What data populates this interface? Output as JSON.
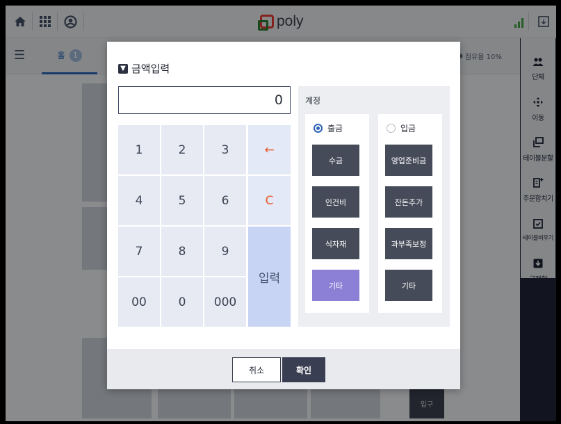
{
  "topbar": {
    "icons": [
      "home-icon",
      "grid-icon",
      "user-icon"
    ],
    "logo_text": "poly",
    "right_icons": [
      "signal-icon",
      "window-icon"
    ]
  },
  "subbar": {
    "hall_tab": "홀",
    "hall_count": "1",
    "occupancy": "점유율 10%"
  },
  "entrance_label": "입구",
  "sidebar": {
    "items": [
      {
        "label": "단체",
        "icon": "group-icon"
      },
      {
        "label": "이동",
        "icon": "move-icon"
      },
      {
        "label": "테이블분할",
        "icon": "split-icon"
      },
      {
        "label": "주문합치기",
        "icon": "merge-order-icon"
      },
      {
        "label": "테이블비우기",
        "icon": "clear-table-icon"
      },
      {
        "label": "금전함",
        "icon": "cash-drawer-icon"
      }
    ]
  },
  "dialog": {
    "title": "금액입력",
    "amount_value": "0",
    "keypad": {
      "row1": [
        "1",
        "2",
        "3"
      ],
      "row2": [
        "4",
        "5",
        "6"
      ],
      "row3": [
        "7",
        "8",
        "9"
      ],
      "row4": [
        "00",
        "0",
        "000"
      ],
      "backspace": "←",
      "clear": "C",
      "enter": "입력"
    },
    "account": {
      "title": "계정",
      "out_label": "출금",
      "in_label": "입금",
      "out_buttons": [
        "수금",
        "인건비",
        "식자재",
        "기타"
      ],
      "in_buttons": [
        "영업준비금",
        "잔돈추가",
        "과부족보정",
        "기타"
      ]
    },
    "cancel": "취소",
    "confirm": "확인"
  }
}
